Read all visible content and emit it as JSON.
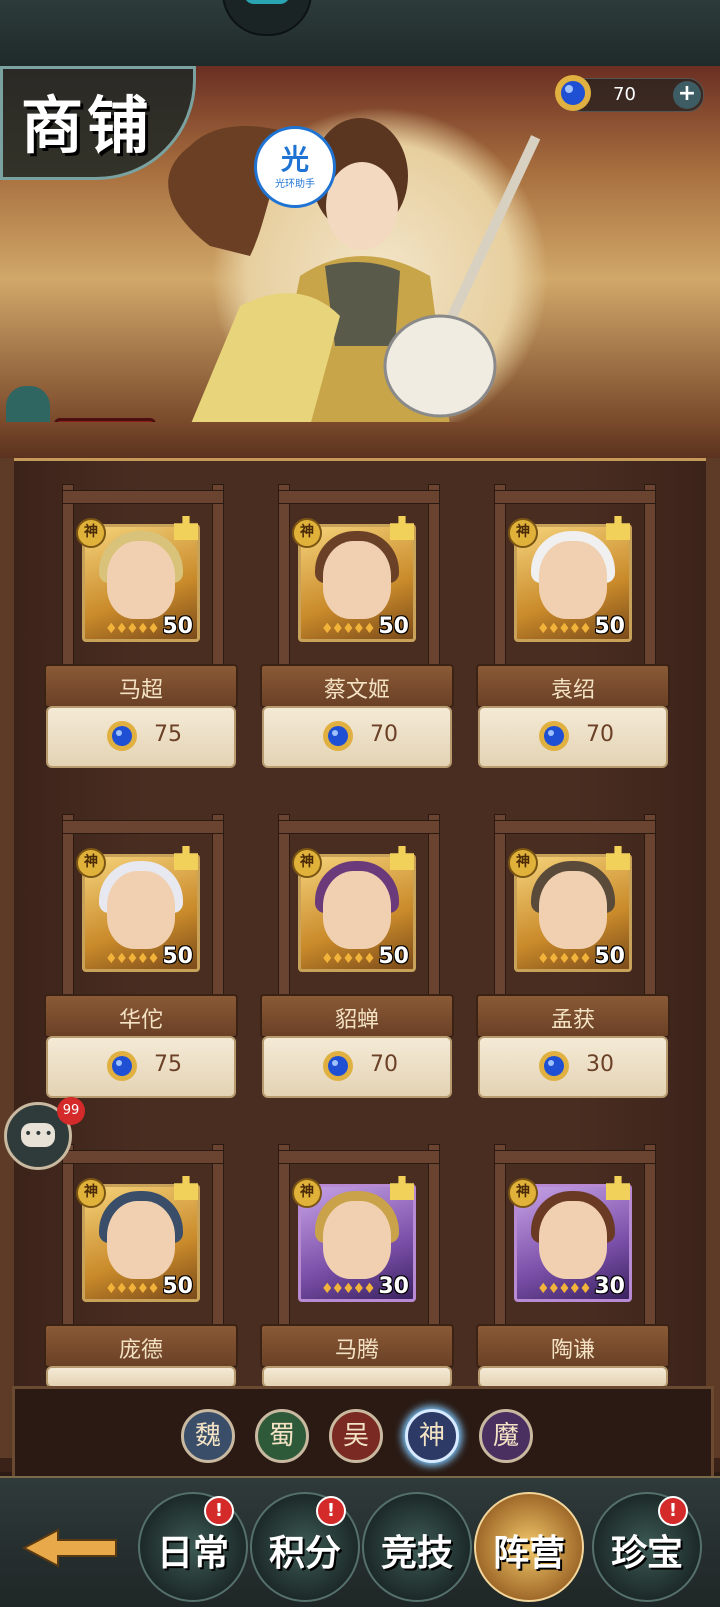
{
  "header": {
    "title": "商铺",
    "currency_amount": "70",
    "plus_label": "+",
    "watermark": {
      "glyph": "光",
      "text": "光环助手"
    }
  },
  "shop": {
    "items": [
      {
        "name": "马超",
        "badge": "神",
        "stars": "♦♦♦♦♦",
        "level": "50",
        "price": "75",
        "frame": "gold"
      },
      {
        "name": "蔡文姬",
        "badge": "神",
        "stars": "♦♦♦♦♦",
        "level": "50",
        "price": "70",
        "frame": "gold"
      },
      {
        "name": "袁绍",
        "badge": "神",
        "stars": "♦♦♦♦♦",
        "level": "50",
        "price": "70",
        "frame": "gold"
      },
      {
        "name": "华佗",
        "badge": "神",
        "stars": "♦♦♦♦♦",
        "level": "50",
        "price": "75",
        "frame": "gold"
      },
      {
        "name": "貂蝉",
        "badge": "神",
        "stars": "♦♦♦♦♦",
        "level": "50",
        "price": "70",
        "frame": "gold"
      },
      {
        "name": "孟获",
        "badge": "神",
        "stars": "♦♦♦♦♦",
        "level": "50",
        "price": "30",
        "frame": "gold"
      },
      {
        "name": "庞德",
        "badge": "神",
        "stars": "♦♦♦♦♦",
        "level": "50",
        "price": "",
        "frame": "gold"
      },
      {
        "name": "马腾",
        "badge": "神",
        "stars": "♦♦♦♦♦",
        "level": "30",
        "price": "",
        "frame": "purple"
      },
      {
        "name": "陶谦",
        "badge": "神",
        "stars": "♦♦♦♦♦",
        "level": "30",
        "price": "",
        "frame": "purple"
      }
    ]
  },
  "chat": {
    "unread": "99"
  },
  "factions": [
    {
      "label": "魏",
      "color": "#3a4e6a",
      "active": false
    },
    {
      "label": "蜀",
      "color": "#2f5a3a",
      "active": false
    },
    {
      "label": "吴",
      "color": "#7a2a22",
      "active": false
    },
    {
      "label": "神",
      "color": "#2e3a66",
      "active": true
    },
    {
      "label": "魔",
      "color": "#4a3060",
      "active": false
    }
  ],
  "bottom_tabs": [
    {
      "label": "日常",
      "alert": "!",
      "active": false
    },
    {
      "label": "积分",
      "alert": "!",
      "active": false
    },
    {
      "label": "竞技",
      "alert": "",
      "active": false
    },
    {
      "label": "阵营",
      "alert": "",
      "active": true
    },
    {
      "label": "珍宝",
      "alert": "!",
      "active": false
    }
  ],
  "colors": {
    "accent_gold": "#c9a25a",
    "alert_red": "#d42a2a",
    "gem_blue": "#1f4fd3"
  },
  "icons": {
    "gem": "blue-gem-icon",
    "back": "back-arrow-icon",
    "chat": "chat-bubble-icon",
    "plus": "plus-icon"
  }
}
